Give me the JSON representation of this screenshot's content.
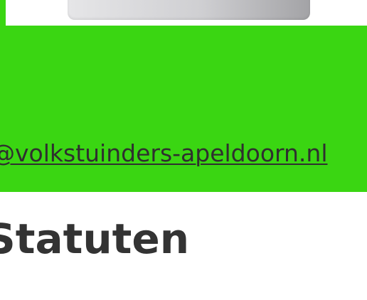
{
  "contact": {
    "email_link": "@volkstuinders-apeldoorn.nl"
  },
  "main": {
    "title": "Statuten"
  },
  "colors": {
    "banner": "#3ad612",
    "text": "#333333"
  }
}
